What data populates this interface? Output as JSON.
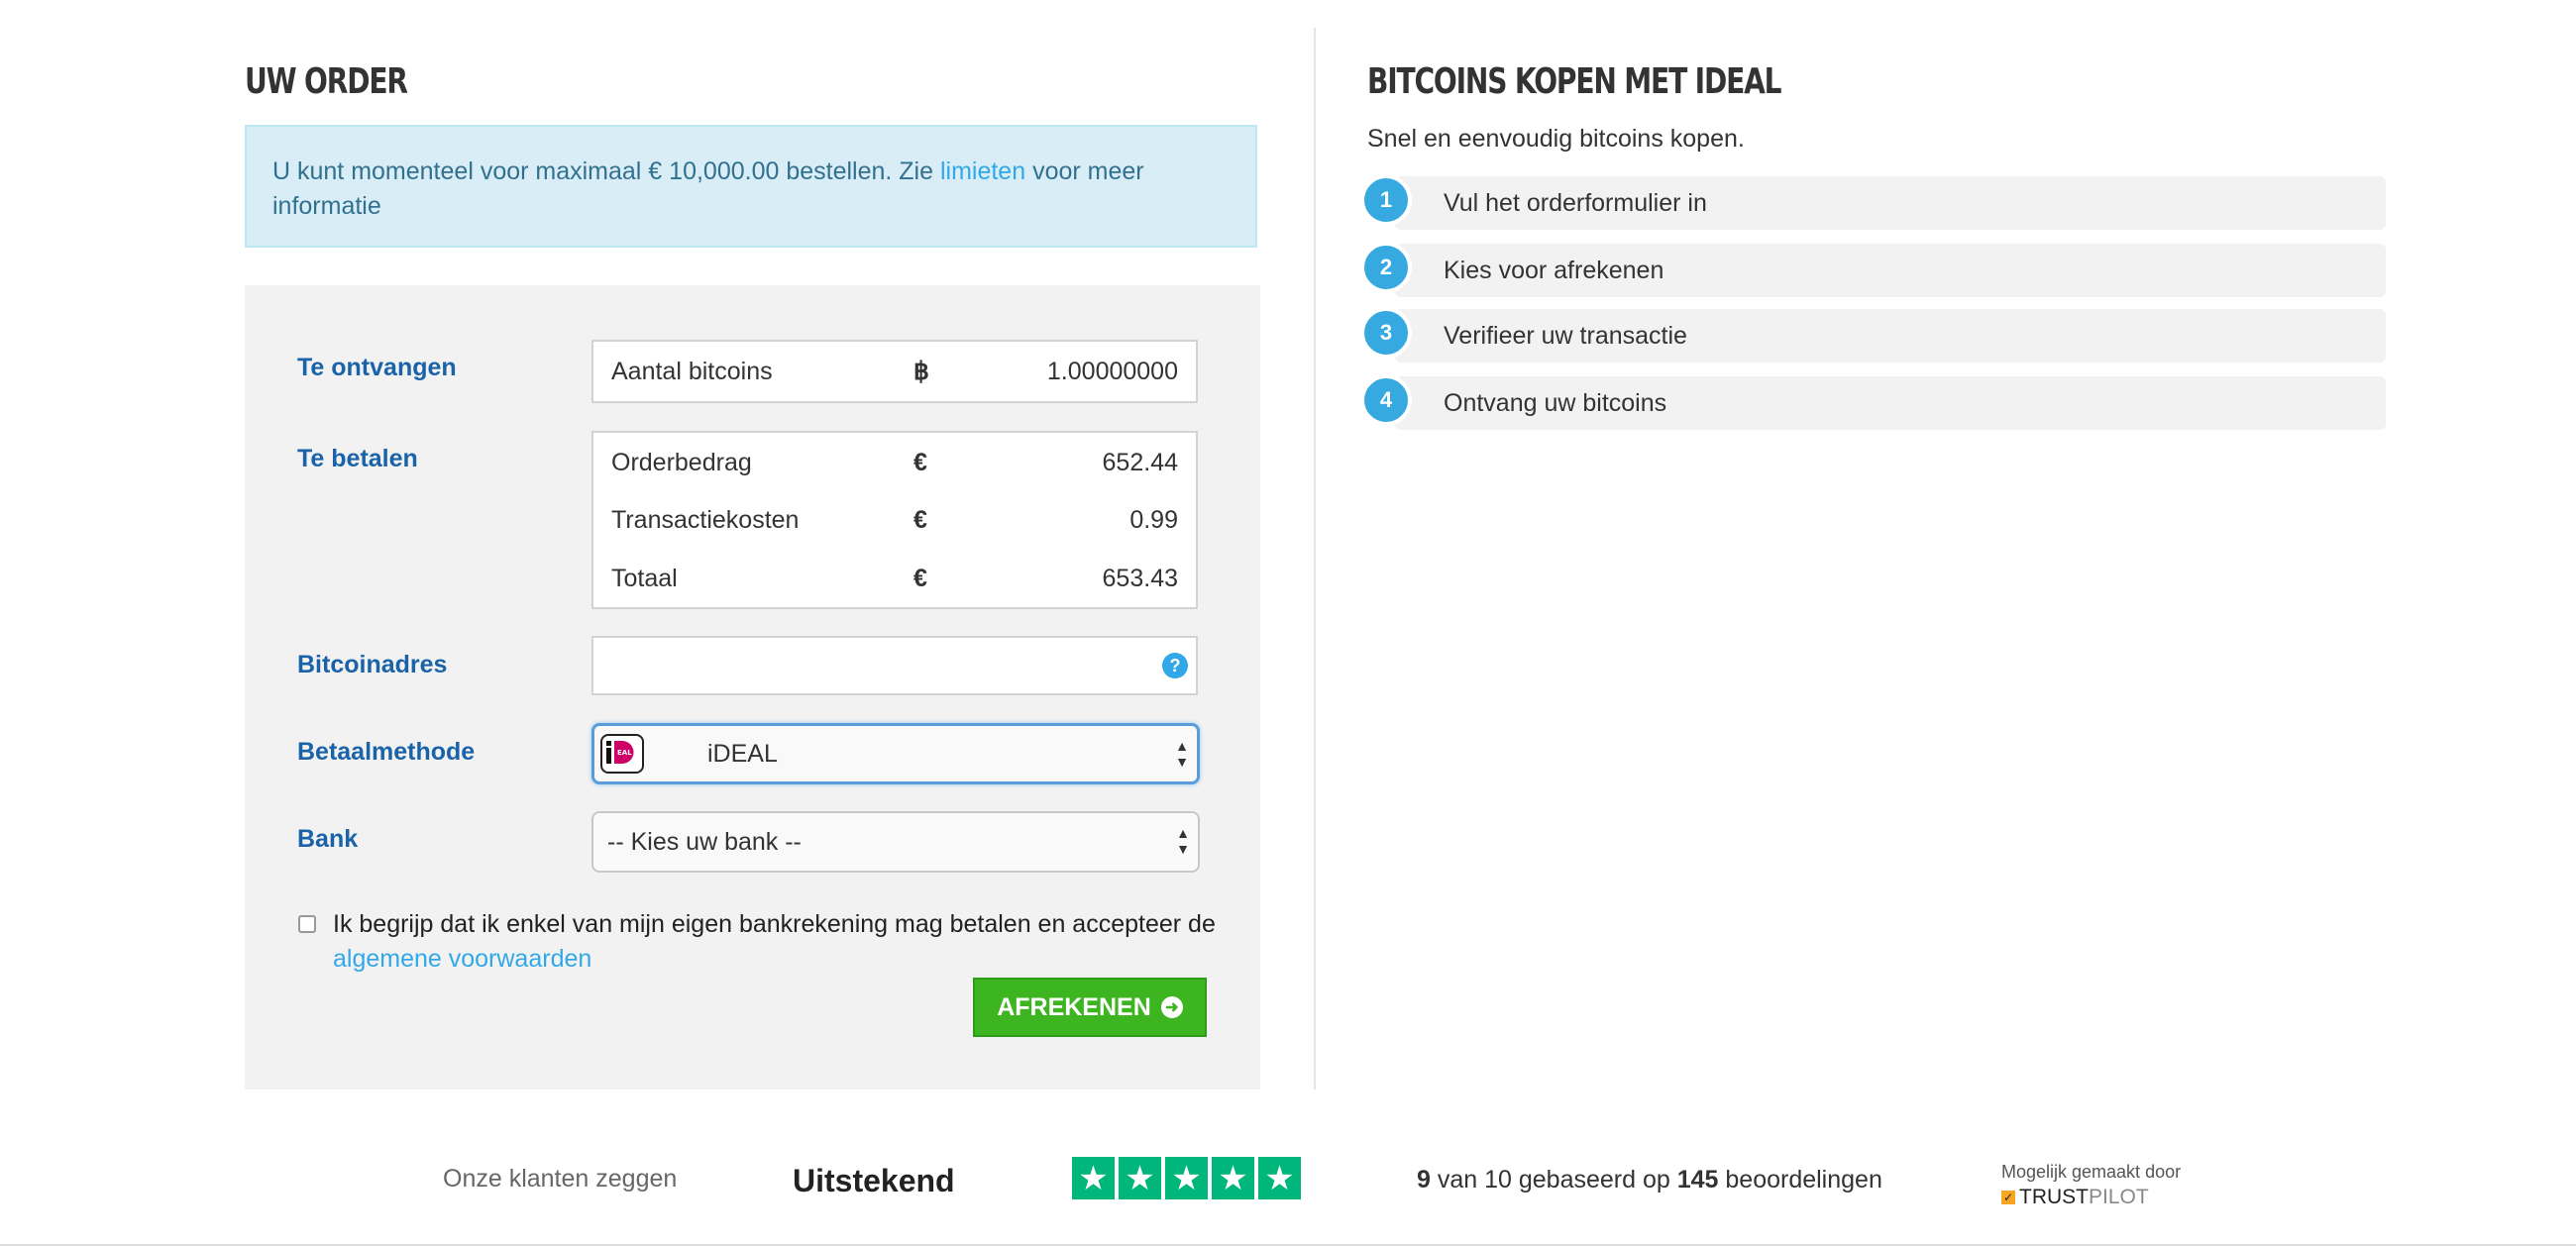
{
  "order": {
    "title": "UW ORDER",
    "alert": {
      "text_before": "U kunt momenteel voor maximaal € 10,000.00 bestellen. Zie ",
      "link": "limieten",
      "text_after": " voor meer informatie"
    },
    "receive": {
      "label": "Te ontvangen",
      "row_label": "Aantal bitcoins",
      "currency": "฿",
      "value": "1.00000000"
    },
    "pay": {
      "label": "Te betalen",
      "rows": [
        {
          "label": "Orderbedrag",
          "currency": "€",
          "value": "652.44"
        },
        {
          "label": "Transactiekosten",
          "currency": "€",
          "value": "0.99"
        },
        {
          "label": "Totaal",
          "currency": "€",
          "value": "653.43"
        }
      ]
    },
    "address": {
      "label": "Bitcoinadres",
      "value": "",
      "help": "?"
    },
    "method": {
      "label": "Betaalmethode",
      "selected": "iDEAL",
      "logo_text": "iD"
    },
    "bank": {
      "label": "Bank",
      "selected": "-- Kies uw bank --"
    },
    "terms": {
      "checked": false,
      "text": "Ik begrijp dat ik enkel van mijn eigen bankrekening mag betalen en accepteer de ",
      "link": "algemene voorwaarden"
    },
    "submit_label": "AFREKENEN"
  },
  "info": {
    "title": "BITCOINS KOPEN MET IDEAL",
    "subtitle": "Snel en eenvoudig bitcoins kopen.",
    "steps": [
      {
        "num": "1",
        "text": "Vul het orderformulier in"
      },
      {
        "num": "2",
        "text": "Kies voor afrekenen"
      },
      {
        "num": "3",
        "text": "Verifieer uw transactie"
      },
      {
        "num": "4",
        "text": "Ontvang uw bitcoins"
      }
    ]
  },
  "trustpilot": {
    "intro": "Onze klanten zeggen",
    "rating_word": "Uitstekend",
    "stars": 5,
    "score": "9",
    "score_text_1": " van 10 gebaseerd op ",
    "count": "145",
    "score_text_2": " beoordelingen",
    "powered_by": "Mogelijk gemaakt door",
    "brand_1": "TRUST",
    "brand_2": "PILOT"
  },
  "colors": {
    "label_blue": "#1a63a8",
    "link_blue": "#32a8e8",
    "step_blue": "#36a9e1",
    "button_green": "#3cb521",
    "trustpilot_green": "#00b67a"
  }
}
